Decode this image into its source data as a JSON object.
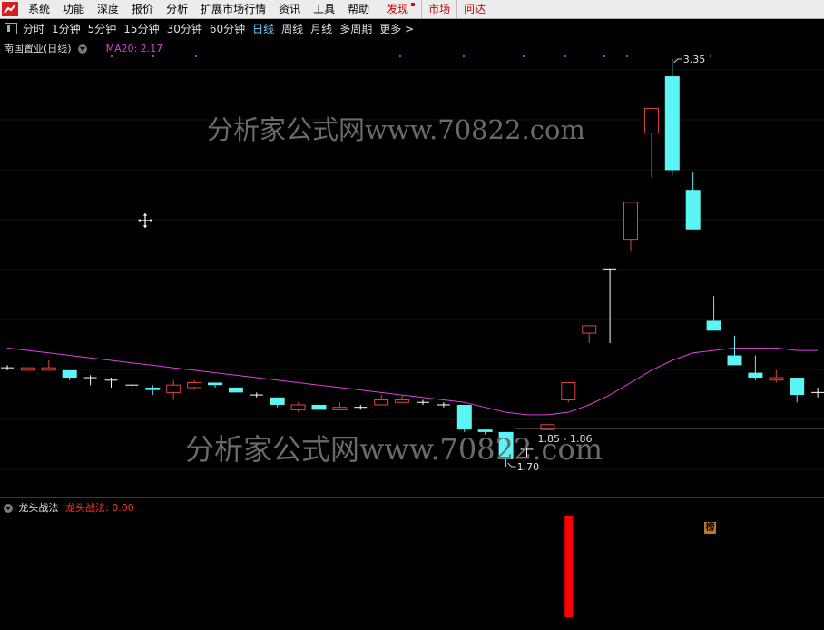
{
  "menu": {
    "items": [
      "系统",
      "功能",
      "深度",
      "报价",
      "分析",
      "扩展市场行情",
      "资讯",
      "工具",
      "帮助"
    ],
    "discover": "发现",
    "market": "市场",
    "wenda": "问达"
  },
  "toolbar": {
    "periods": [
      "分时",
      "1分钟",
      "5分钟",
      "15分钟",
      "30分钟",
      "60分钟",
      "日线",
      "周线",
      "月线",
      "多周期",
      "更多 >"
    ],
    "active": "日线"
  },
  "main": {
    "stock_title": "南国置业(日线)",
    "ma_label": "MA20: 2.17",
    "high_label": "3.35",
    "low_label": "1.70",
    "range_label": "1.85 - 1.86",
    "bang": "榜",
    "watermark": "分析家公式网www.70822.com"
  },
  "indicator": {
    "name": "龙头战法",
    "value_label": "龙头战法: 0.00"
  },
  "colors": {
    "up": "#e0453c",
    "down": "#5cf5f5",
    "doji": "#ffffff",
    "ma": "#e040e0",
    "signal": "#ff0000"
  },
  "chart_data": {
    "type": "candlestick",
    "high": 3.35,
    "low": 1.7,
    "ma20_last": 2.17,
    "candles": [
      {
        "o": 2.1,
        "c": 2.1,
        "h": 2.11,
        "l": 2.09
      },
      {
        "o": 2.09,
        "c": 2.1,
        "h": 2.1,
        "l": 2.09
      },
      {
        "o": 2.09,
        "c": 2.1,
        "h": 2.13,
        "l": 2.09
      },
      {
        "o": 2.09,
        "c": 2.06,
        "h": 2.09,
        "l": 2.05
      },
      {
        "o": 2.06,
        "c": 2.06,
        "h": 2.07,
        "l": 2.03
      },
      {
        "o": 2.05,
        "c": 2.05,
        "h": 2.06,
        "l": 2.02
      },
      {
        "o": 2.03,
        "c": 2.03,
        "h": 2.04,
        "l": 2.01
      },
      {
        "o": 2.02,
        "c": 2.01,
        "h": 2.03,
        "l": 1.99
      },
      {
        "o": 2.0,
        "c": 2.03,
        "h": 2.05,
        "l": 1.97
      },
      {
        "o": 2.02,
        "c": 2.04,
        "h": 2.05,
        "l": 2.01
      },
      {
        "o": 2.04,
        "c": 2.03,
        "h": 2.04,
        "l": 2.02
      },
      {
        "o": 2.02,
        "c": 2.0,
        "h": 2.02,
        "l": 2.0
      },
      {
        "o": 1.99,
        "c": 1.99,
        "h": 2.0,
        "l": 1.98
      },
      {
        "o": 1.98,
        "c": 1.95,
        "h": 1.98,
        "l": 1.94
      },
      {
        "o": 1.93,
        "c": 1.95,
        "h": 1.96,
        "l": 1.92
      },
      {
        "o": 1.95,
        "c": 1.93,
        "h": 1.95,
        "l": 1.92
      },
      {
        "o": 1.93,
        "c": 1.94,
        "h": 1.96,
        "l": 1.93
      },
      {
        "o": 1.94,
        "c": 1.94,
        "h": 1.95,
        "l": 1.93
      },
      {
        "o": 1.95,
        "c": 1.97,
        "h": 1.99,
        "l": 1.95
      },
      {
        "o": 1.96,
        "c": 1.97,
        "h": 1.99,
        "l": 1.96
      },
      {
        "o": 1.96,
        "c": 1.96,
        "h": 1.97,
        "l": 1.95
      },
      {
        "o": 1.95,
        "c": 1.95,
        "h": 1.96,
        "l": 1.94
      },
      {
        "o": 1.95,
        "c": 1.85,
        "h": 1.95,
        "l": 1.84
      },
      {
        "o": 1.85,
        "c": 1.84,
        "h": 1.85,
        "l": 1.83
      },
      {
        "o": 1.84,
        "c": 1.73,
        "h": 1.84,
        "l": 1.7
      },
      {
        "o": 1.77,
        "c": 1.77,
        "h": 1.81,
        "l": 1.74
      },
      {
        "o": 1.85,
        "c": 1.87,
        "h": 1.87,
        "l": 1.85
      },
      {
        "o": 1.97,
        "c": 2.04,
        "h": 2.04,
        "l": 1.96
      },
      {
        "o": 2.24,
        "c": 2.27,
        "h": 2.27,
        "l": 2.2
      },
      {
        "o": 2.5,
        "c": 2.5,
        "h": 2.5,
        "l": 2.2
      },
      {
        "o": 2.62,
        "c": 2.77,
        "h": 2.77,
        "l": 2.57
      },
      {
        "o": 3.05,
        "c": 3.15,
        "h": 3.15,
        "l": 2.87
      },
      {
        "o": 3.28,
        "c": 2.9,
        "h": 3.35,
        "l": 2.88
      },
      {
        "o": 2.82,
        "c": 2.66,
        "h": 2.89,
        "l": 2.66
      },
      {
        "o": 2.29,
        "c": 2.25,
        "h": 2.39,
        "l": 2.25
      },
      {
        "o": 2.15,
        "c": 2.11,
        "h": 2.23,
        "l": 2.11
      },
      {
        "o": 2.08,
        "c": 2.06,
        "h": 2.15,
        "l": 2.05
      },
      {
        "o": 2.05,
        "c": 2.06,
        "h": 2.09,
        "l": 2.04
      },
      {
        "o": 2.06,
        "c": 1.99,
        "h": 2.06,
        "l": 1.96
      },
      {
        "o": 2.0,
        "c": 2.0,
        "h": 2.02,
        "l": 1.98
      }
    ],
    "ma20": [
      2.18,
      2.17,
      2.16,
      2.15,
      2.14,
      2.13,
      2.12,
      2.11,
      2.1,
      2.09,
      2.08,
      2.07,
      2.06,
      2.05,
      2.04,
      2.03,
      2.02,
      2.01,
      2.0,
      1.99,
      1.98,
      1.97,
      1.96,
      1.94,
      1.92,
      1.91,
      1.91,
      1.92,
      1.95,
      1.99,
      2.04,
      2.09,
      2.13,
      2.16,
      2.17,
      2.18,
      2.18,
      2.18,
      2.17,
      2.17
    ],
    "indicator_bars": [
      {
        "index": 27,
        "value": 1
      }
    ]
  }
}
